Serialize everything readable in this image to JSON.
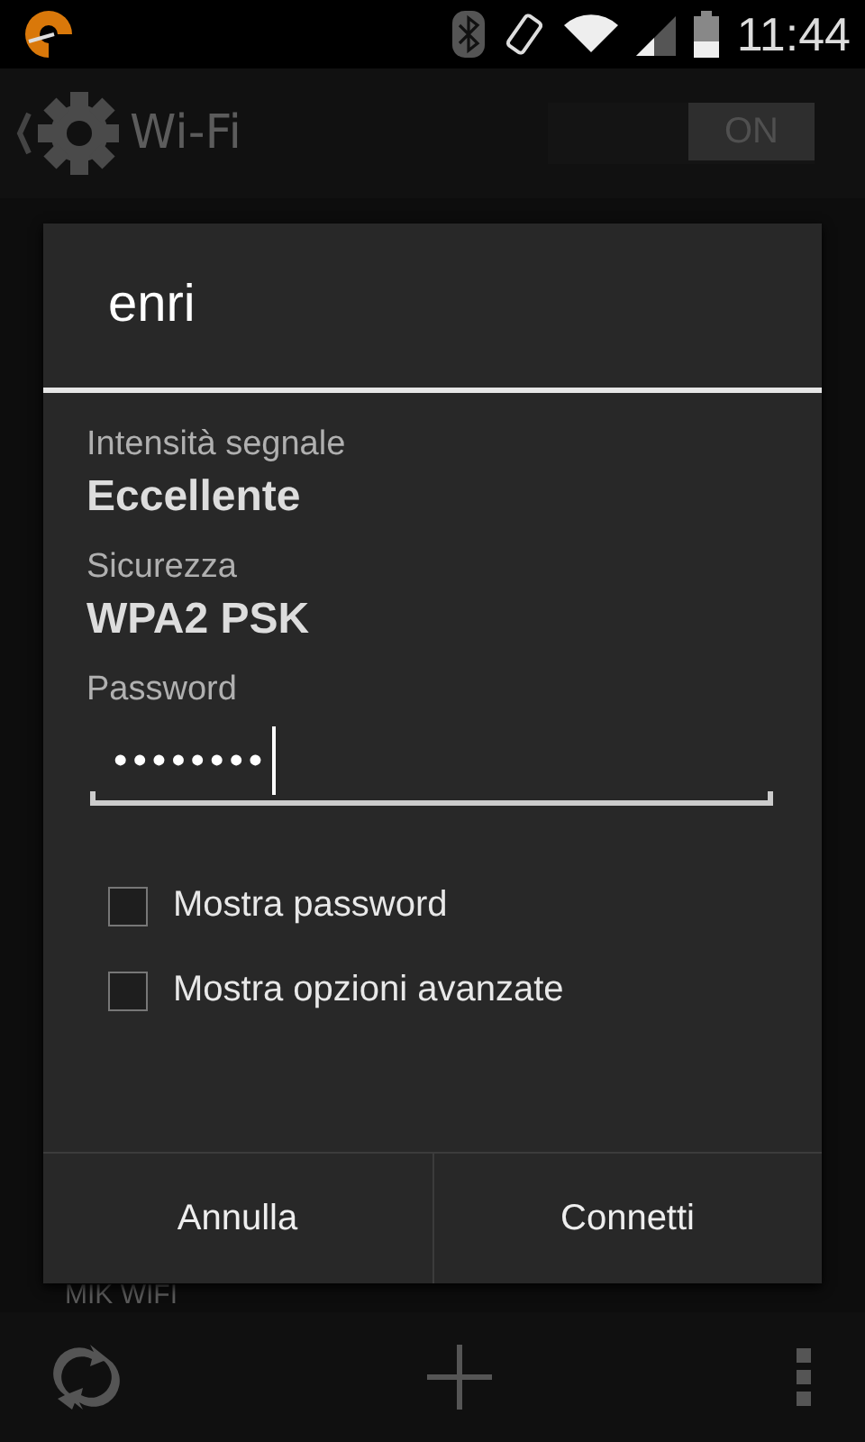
{
  "status_bar": {
    "time": "11:44"
  },
  "action_bar": {
    "title": "Wi-Fi",
    "switch": {
      "label": "ON",
      "on": true
    }
  },
  "background_list": {
    "items": [
      "MIK WIFI"
    ]
  },
  "dialog": {
    "title": "enri",
    "fields": [
      {
        "label": "Intensità segnale",
        "value": "Eccellente"
      },
      {
        "label": "Sicurezza",
        "value": "WPA2 PSK"
      }
    ],
    "password": {
      "label": "Password",
      "value": "••••••••"
    },
    "checkboxes": [
      {
        "label": "Mostra password",
        "checked": false
      },
      {
        "label": "Mostra opzioni avanzate",
        "checked": false
      }
    ],
    "buttons": [
      "Annulla",
      "Connetti"
    ]
  }
}
